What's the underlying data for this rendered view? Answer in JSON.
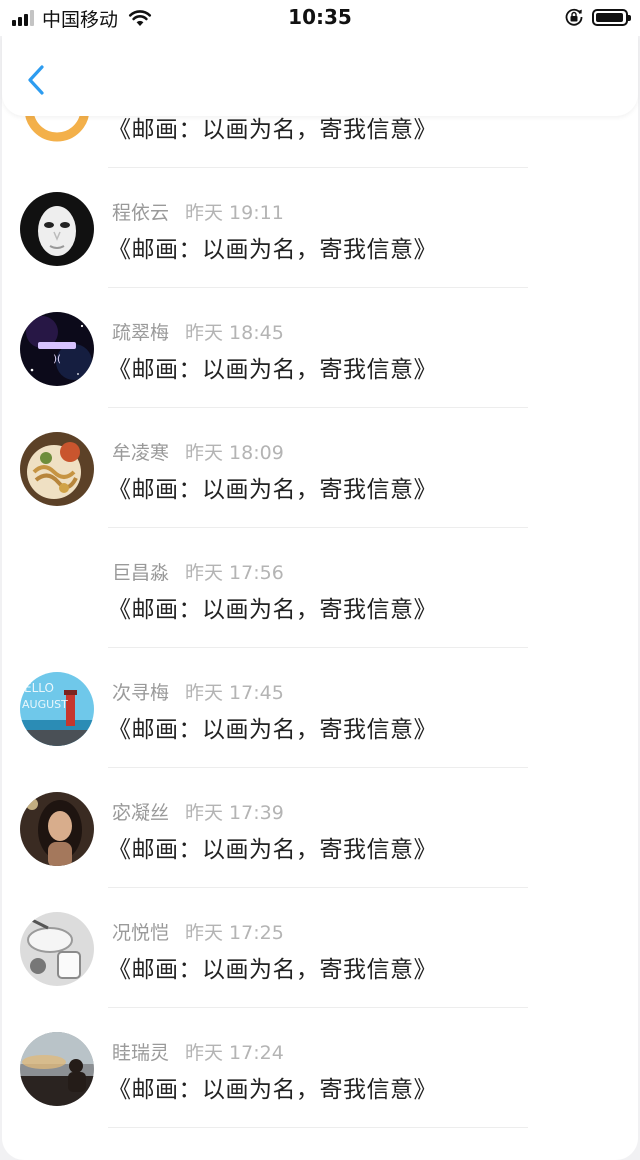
{
  "status_bar": {
    "carrier": "中国移动",
    "time": "10:35",
    "battery_level": 0.95
  },
  "nav": {
    "back_icon": "chevron-left-icon",
    "accent_color": "#2d9cf0"
  },
  "messages": [
    {
      "name": "",
      "time": "",
      "text": "《邮画：以画为名，寄我信意》",
      "avatar": "partial-avatar"
    },
    {
      "name": "程依云",
      "time": "昨天 19:11",
      "text": "《邮画：以画为名，寄我信意》",
      "avatar": "white-mask-avatar"
    },
    {
      "name": "疏翠梅",
      "time": "昨天 18:45",
      "text": "《邮画：以画为名，寄我信意》",
      "avatar": "pisces-galaxy-avatar"
    },
    {
      "name": "牟凌寒",
      "time": "昨天 18:09",
      "text": "《邮画：以画为名，寄我信意》",
      "avatar": "noodle-bowl-avatar"
    },
    {
      "name": "巨昌淼",
      "time": "昨天 17:56",
      "text": "《邮画：以画为名，寄我信意》",
      "avatar": ""
    },
    {
      "name": "次寻梅",
      "time": "昨天 17:45",
      "text": "《邮画：以画为名，寄我信意》",
      "avatar": "hello-august-lighthouse-avatar"
    },
    {
      "name": "宓凝丝",
      "time": "昨天 17:39",
      "text": "《邮画：以画为名，寄我信意》",
      "avatar": "girl-portrait-avatar"
    },
    {
      "name": "况悦恺",
      "time": "昨天 17:25",
      "text": "《邮画：以画为名，寄我信意》",
      "avatar": "monochrome-dishes-avatar"
    },
    {
      "name": "眭瑞灵",
      "time": "昨天 17:24",
      "text": "《邮画：以画为名，寄我信意》",
      "avatar": "sunset-silhouette-avatar"
    }
  ]
}
